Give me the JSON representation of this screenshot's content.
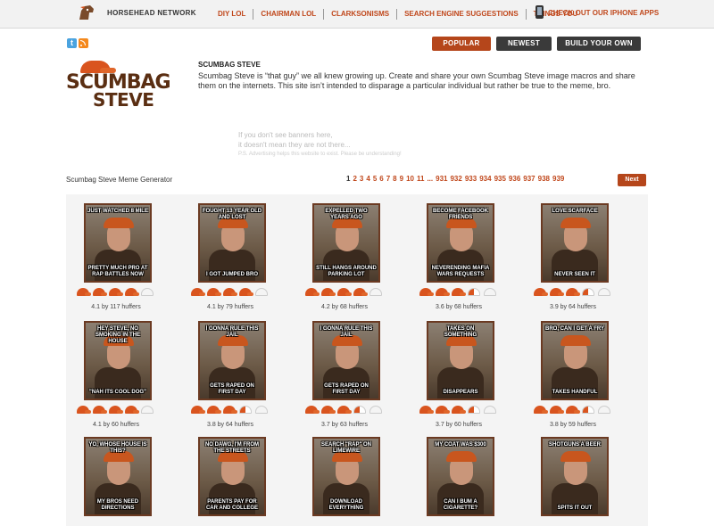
{
  "header": {
    "network": "HORSEHEAD NETWORK",
    "nav": [
      "DIY LOL",
      "CHAIRMAN LOL",
      "CLARKSONISMS",
      "SEARCH ENGINE SUGGESTIONS",
      "THINGS YOU"
    ],
    "iphone_link": "CHECK OUT OUR IPHONE APPS"
  },
  "social": {
    "twitter_icon": "twitter-icon",
    "rss_icon": "rss-icon"
  },
  "tabs": {
    "popular": "POPULAR",
    "newest": "NEWEST",
    "build": "BUILD YOUR OWN"
  },
  "logo": {
    "line1": "SCUMBAG",
    "line2": "STEVE"
  },
  "about": {
    "title": "SCUMBAG STEVE",
    "text": "Scumbag Steve is “that guy” we all knew growing up. Create and share your own Scumbag Steve image macros and share them on the internets. This site isn’t intended to disparage a particular individual but rather be true to the meme, bro."
  },
  "ad_notice": {
    "line1": "If you don't see banners here,",
    "line2": "it doesn't mean they are not there...",
    "line3": "P.S. Advertising helps this website to exist. Please be understanding!"
  },
  "generator": {
    "title": "Scumbag Steve Meme Generator",
    "pages": [
      "1",
      "2",
      "3",
      "4",
      "5",
      "6",
      "7",
      "8",
      "9",
      "10",
      "11",
      "...",
      "931",
      "932",
      "933",
      "934",
      "935",
      "936",
      "937",
      "938",
      "939"
    ],
    "current_page": "1",
    "next": "Next"
  },
  "memes": [
    {
      "top": "Just watched 8 mile",
      "bottom": "Pretty much pro at rap battles now",
      "rating": 4.1,
      "rating_text": "4.1 by 117 huffers"
    },
    {
      "top": "Fought 13 year old and lost",
      "bottom": "I got jumped bro",
      "rating": 4.1,
      "rating_text": "4.1 by 79 huffers"
    },
    {
      "top": "Expelled two years ago",
      "bottom": "Still hangs around parking lot",
      "rating": 4.2,
      "rating_text": "4.2 by 68 huffers"
    },
    {
      "top": "Become Facebook friends",
      "bottom": "Neverending mafia wars requests",
      "rating": 3.6,
      "rating_text": "3.6 by 68 huffers"
    },
    {
      "top": "Love Scarface",
      "bottom": "Never seen it",
      "rating": 3.9,
      "rating_text": "3.9 by 64 huffers"
    },
    {
      "top": "Hey Steve, no smoking in the house",
      "bottom": "\"Nah its cool dog\"",
      "rating": 4.1,
      "rating_text": "4.1 by 60 huffers"
    },
    {
      "top": "I gonna rule this jail",
      "bottom": "Gets raped on first day",
      "rating": 3.8,
      "rating_text": "3.8 by 64 huffers"
    },
    {
      "top": "I gonna rule this jail",
      "bottom": "Gets raped on first day",
      "rating": 3.7,
      "rating_text": "3.7 by 63 huffers"
    },
    {
      "top": "Takes on something",
      "bottom": "Disappears",
      "rating": 3.7,
      "rating_text": "3.7 by 60 huffers"
    },
    {
      "top": "Bro, can I get a fry",
      "bottom": "Takes handful",
      "rating": 3.8,
      "rating_text": "3.8 by 59 huffers"
    },
    {
      "top": "Yo, whose house is this?",
      "bottom": "My bros need directions",
      "rating": null,
      "rating_text": ""
    },
    {
      "top": "No dawg, I'm from the streets",
      "bottom": "Parents pay for car and college",
      "rating": null,
      "rating_text": ""
    },
    {
      "top": "Search \"rap\" on limewire",
      "bottom": "Download everything",
      "rating": null,
      "rating_text": ""
    },
    {
      "top": "My coat was $300",
      "bottom": "Can I bum a cigarette?",
      "rating": null,
      "rating_text": ""
    },
    {
      "top": "Shotguns a beer",
      "bottom": "Spits it out",
      "rating": null,
      "rating_text": ""
    }
  ],
  "colors": {
    "accent": "#b5461b",
    "link": "#c0471b",
    "dark_button": "#3a3a3a"
  }
}
